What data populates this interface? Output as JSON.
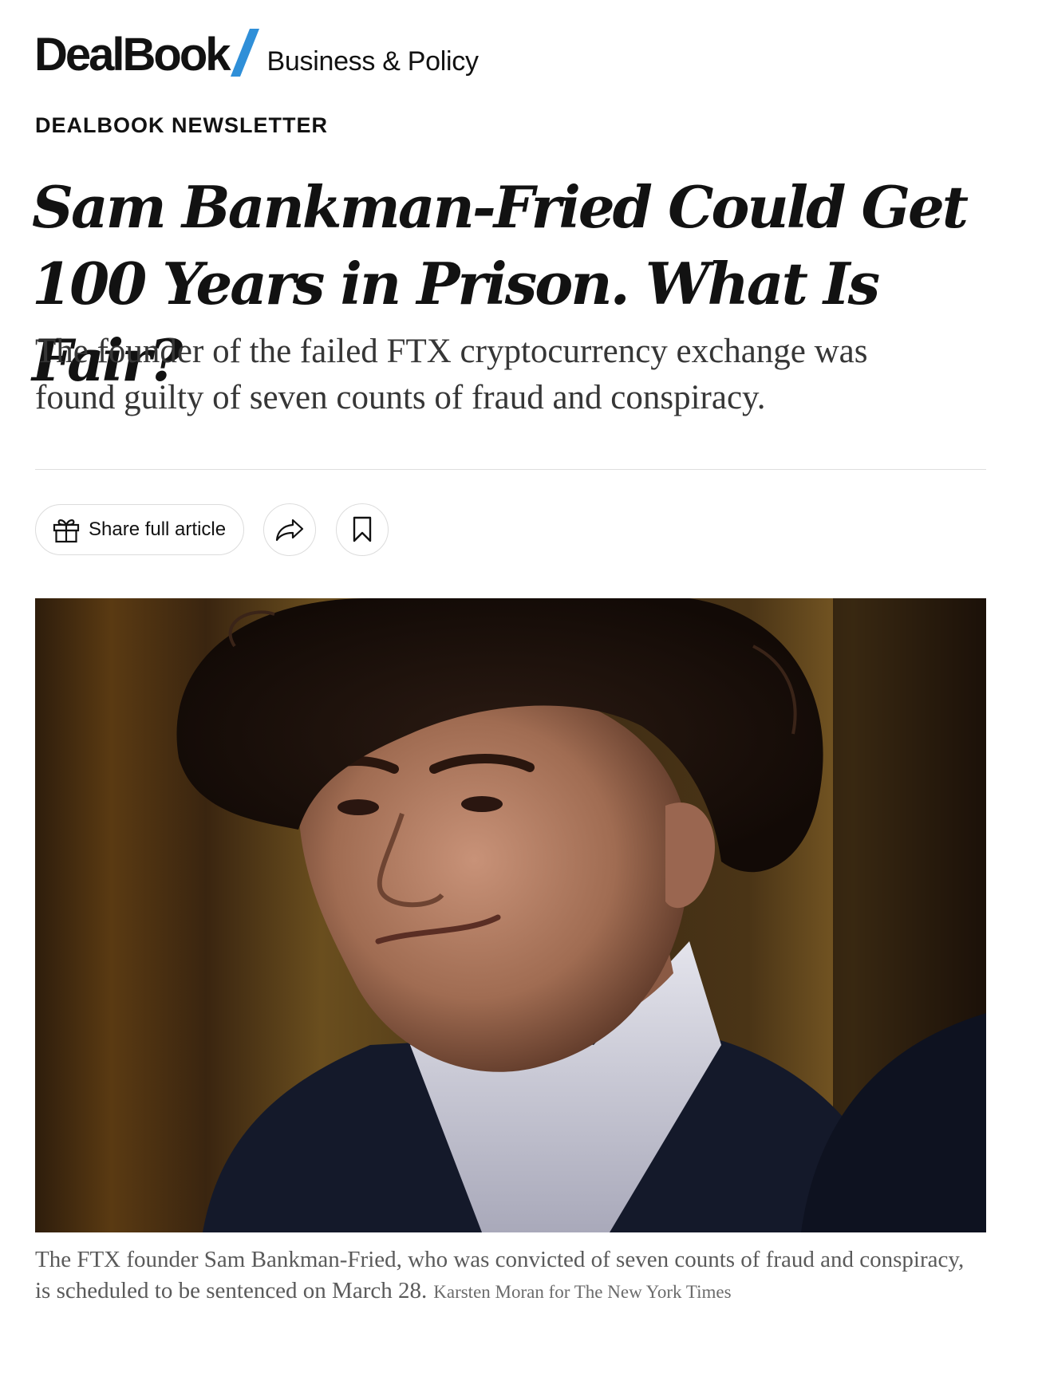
{
  "brand": {
    "logo": "DealBook",
    "section": "Business & Policy",
    "accent_color": "#2f8fd8"
  },
  "kicker": "DEALBOOK NEWSLETTER",
  "headline": "Sam Bankman-Fried Could Get 100 Years in Prison. What Is Fair?",
  "summary": "The founder of the failed FTX cryptocurrency exchange was found guilty of seven counts of fraud and conspiracy.",
  "actions": {
    "share_full_article": "Share full article",
    "gift_icon": "gift-icon",
    "share_icon": "share-arrow-icon",
    "bookmark_icon": "bookmark-icon"
  },
  "image": {
    "subject": "portrait-photo"
  },
  "caption": {
    "text": "The FTX founder Sam Bankman-Fried, who was convicted of seven counts of fraud and conspiracy, is scheduled to be sentenced on March 28.",
    "credit": "Karsten Moran for The New York Times"
  }
}
